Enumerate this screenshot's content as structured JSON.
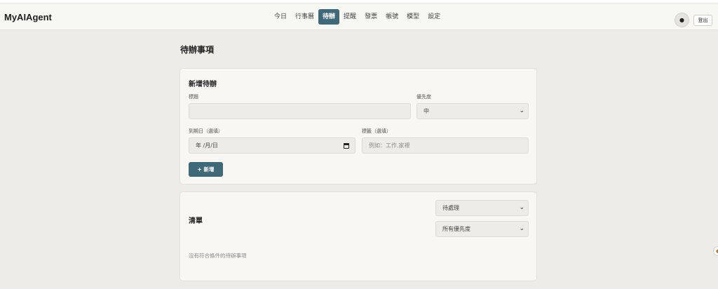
{
  "app": {
    "brand": "MyAIAgent"
  },
  "nav": {
    "items": [
      {
        "label": "今日",
        "active": false
      },
      {
        "label": "行事曆",
        "active": false
      },
      {
        "label": "待辦",
        "active": true
      },
      {
        "label": "提醒",
        "active": false
      },
      {
        "label": "發票",
        "active": false
      },
      {
        "label": "帳號",
        "active": false
      },
      {
        "label": "模型",
        "active": false
      },
      {
        "label": "設定",
        "active": false
      }
    ]
  },
  "header": {
    "theme_icon": "●",
    "logout_label": "登出"
  },
  "page": {
    "title": "待辦事項"
  },
  "form": {
    "title": "新增待辦",
    "title_label": "標題",
    "title_value": "",
    "priority_label": "優先度",
    "priority_value": "中",
    "due_label": "到期日（選填）",
    "due_placeholder": "年 /月/日",
    "tags_label": "標籤（選填）",
    "tags_placeholder": "例如：工作,家裡",
    "add_button": "+ 新增"
  },
  "list": {
    "title": "清單",
    "status_filter": "待處理",
    "priority_filter": "所有優先度",
    "empty_text": "沒有符合條件的待辦事項"
  },
  "icons": {
    "chevron": "⌄",
    "edge_icon": "◐"
  },
  "colors": {
    "accent": "#3f6878",
    "background": "#edece7",
    "card": "#f8f7f4"
  }
}
